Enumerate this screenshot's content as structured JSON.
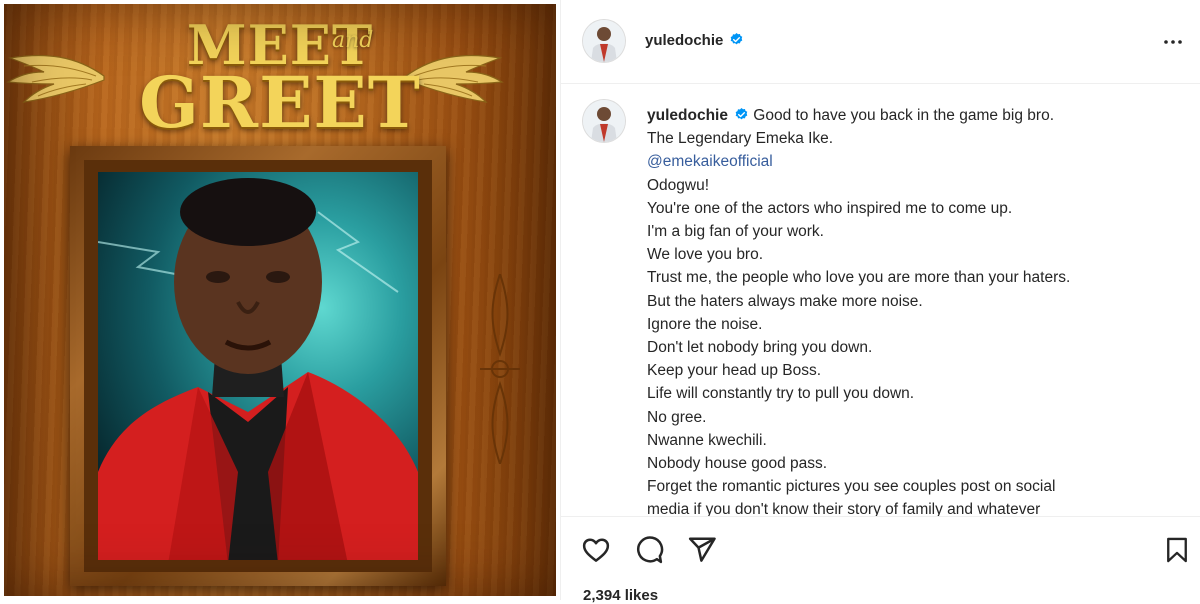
{
  "image": {
    "headline_top": "MEET",
    "headline_and": "and",
    "headline_bottom": "GREET"
  },
  "header": {
    "username": "yuledochie",
    "verified_icon": "verified-badge-icon",
    "more_icon": "more-options-icon"
  },
  "caption": {
    "username": "yuledochie",
    "lines": [
      "Good to have you back in the game big bro.",
      "The Legendary Emeka Ike.",
      "@emekaikeofficial",
      "Odogwu!",
      "You're one of the actors who inspired me to come up.",
      "I'm a big fan of your work.",
      "We love you bro.",
      "Trust me, the people who love you are more than your haters.",
      "But the haters always make more noise.",
      "Ignore the noise.",
      "Don't let nobody bring you down.",
      "Keep your head up Boss.",
      "Life will constantly try to pull you down.",
      "No gree.",
      "Nwanne kwechili.",
      "Nobody house good pass.",
      "Forget the romantic pictures you see couples post on social",
      "media if you don't know their story of family and whatever"
    ]
  },
  "actions": {
    "like_icon": "heart-icon",
    "comment_icon": "comment-icon",
    "share_icon": "share-icon",
    "save_icon": "bookmark-icon",
    "likes_text": "2,394 likes"
  },
  "colors": {
    "verified": "#0095f6",
    "mention": "#375d9c",
    "text": "#262626",
    "divider": "#efefef"
  }
}
